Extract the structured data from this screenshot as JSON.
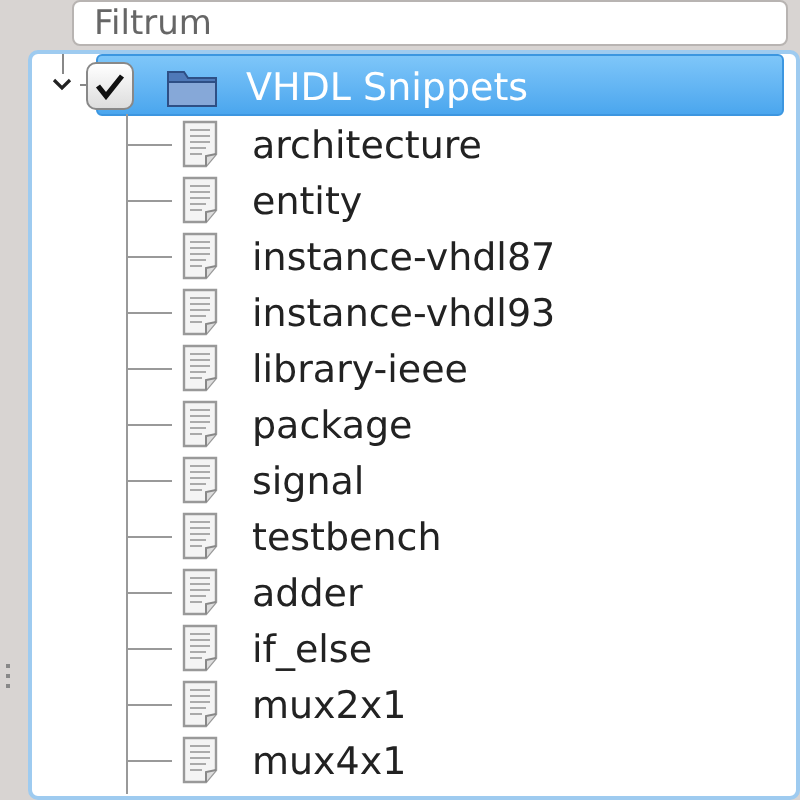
{
  "filter": {
    "placeholder": "Filtrum"
  },
  "tree": [
    {
      "label": "VHDL Snippets",
      "checked": true,
      "selected": true,
      "expanded": true,
      "children": [
        {
          "label": "architecture"
        },
        {
          "label": "entity"
        },
        {
          "label": "instance-vhdl87"
        },
        {
          "label": "instance-vhdl93"
        },
        {
          "label": "library-ieee"
        },
        {
          "label": "package"
        },
        {
          "label": "signal"
        },
        {
          "label": "testbench"
        },
        {
          "label": "adder"
        },
        {
          "label": "if_else"
        },
        {
          "label": "mux2x1"
        },
        {
          "label": "mux4x1"
        }
      ]
    }
  ]
}
